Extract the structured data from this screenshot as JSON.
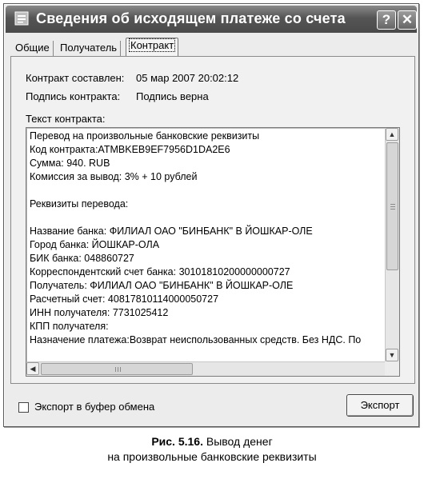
{
  "window": {
    "title": "Сведения об исходящем платеже со счета",
    "help_label": "?",
    "close_label": "✕"
  },
  "tabs": [
    {
      "label": "Общие",
      "active": false
    },
    {
      "label": "Получатель",
      "active": false
    },
    {
      "label": "Контракт",
      "active": true
    }
  ],
  "contract": {
    "created_label": "Контракт составлен:",
    "created_value": "05 мар 2007 20:02:12",
    "signature_label": "Подпись контракта:",
    "signature_value": "Подпись верна",
    "text_label": "Текст контракта:",
    "text_lines": [
      "Перевод на произвольные банковские реквизиты",
      "Код контракта:ATMBKEB9EF7956D1DA2E6",
      "Сумма: 940. RUB",
      "Комиссия за вывод: 3% + 10 рублей",
      "",
      "Реквизиты перевода:",
      "",
      "Название банка: ФИЛИАЛ ОАО \"БИНБАНК\" В ЙОШКАР-ОЛЕ",
      "Город банка: ЙОШКАР-ОЛА",
      "БИК банка: 048860727",
      "Корреспондентский счет банка: 30101810200000000727",
      "Получатель: ФИЛИАЛ ОАО \"БИНБАНК\" В ЙОШКАР-ОЛЕ",
      "Расчетный счет: 40817810114000050727",
      "ИНН получателя: 7731025412",
      "КПП получателя:",
      "Назначение платежа:Возврат неиспользованных средств. Без НДС. По"
    ]
  },
  "footer": {
    "export_clipboard_label": "Экспорт в буфер обмена",
    "export_clipboard_checked": false,
    "export_button": "Экспорт"
  },
  "caption": {
    "figure": "Рис. 5.16.",
    "line1": "Вывод денег",
    "line2": "на произвольные банковские реквизиты"
  }
}
